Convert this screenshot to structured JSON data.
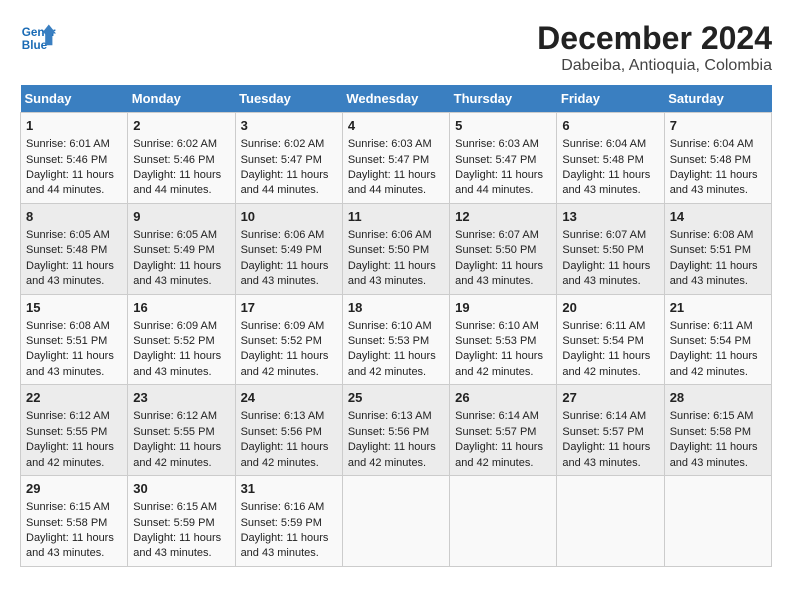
{
  "header": {
    "logo_line1": "General",
    "logo_line2": "Blue",
    "title": "December 2024",
    "subtitle": "Dabeiba, Antioquia, Colombia"
  },
  "calendar": {
    "days_of_week": [
      "Sunday",
      "Monday",
      "Tuesday",
      "Wednesday",
      "Thursday",
      "Friday",
      "Saturday"
    ],
    "weeks": [
      [
        {
          "day": 1,
          "sunrise": "6:01 AM",
          "sunset": "5:46 PM",
          "daylight": "11 hours and 44 minutes."
        },
        {
          "day": 2,
          "sunrise": "6:02 AM",
          "sunset": "5:46 PM",
          "daylight": "11 hours and 44 minutes."
        },
        {
          "day": 3,
          "sunrise": "6:02 AM",
          "sunset": "5:47 PM",
          "daylight": "11 hours and 44 minutes."
        },
        {
          "day": 4,
          "sunrise": "6:03 AM",
          "sunset": "5:47 PM",
          "daylight": "11 hours and 44 minutes."
        },
        {
          "day": 5,
          "sunrise": "6:03 AM",
          "sunset": "5:47 PM",
          "daylight": "11 hours and 44 minutes."
        },
        {
          "day": 6,
          "sunrise": "6:04 AM",
          "sunset": "5:48 PM",
          "daylight": "11 hours and 43 minutes."
        },
        {
          "day": 7,
          "sunrise": "6:04 AM",
          "sunset": "5:48 PM",
          "daylight": "11 hours and 43 minutes."
        }
      ],
      [
        {
          "day": 8,
          "sunrise": "6:05 AM",
          "sunset": "5:48 PM",
          "daylight": "11 hours and 43 minutes."
        },
        {
          "day": 9,
          "sunrise": "6:05 AM",
          "sunset": "5:49 PM",
          "daylight": "11 hours and 43 minutes."
        },
        {
          "day": 10,
          "sunrise": "6:06 AM",
          "sunset": "5:49 PM",
          "daylight": "11 hours and 43 minutes."
        },
        {
          "day": 11,
          "sunrise": "6:06 AM",
          "sunset": "5:50 PM",
          "daylight": "11 hours and 43 minutes."
        },
        {
          "day": 12,
          "sunrise": "6:07 AM",
          "sunset": "5:50 PM",
          "daylight": "11 hours and 43 minutes."
        },
        {
          "day": 13,
          "sunrise": "6:07 AM",
          "sunset": "5:50 PM",
          "daylight": "11 hours and 43 minutes."
        },
        {
          "day": 14,
          "sunrise": "6:08 AM",
          "sunset": "5:51 PM",
          "daylight": "11 hours and 43 minutes."
        }
      ],
      [
        {
          "day": 15,
          "sunrise": "6:08 AM",
          "sunset": "5:51 PM",
          "daylight": "11 hours and 43 minutes."
        },
        {
          "day": 16,
          "sunrise": "6:09 AM",
          "sunset": "5:52 PM",
          "daylight": "11 hours and 43 minutes."
        },
        {
          "day": 17,
          "sunrise": "6:09 AM",
          "sunset": "5:52 PM",
          "daylight": "11 hours and 42 minutes."
        },
        {
          "day": 18,
          "sunrise": "6:10 AM",
          "sunset": "5:53 PM",
          "daylight": "11 hours and 42 minutes."
        },
        {
          "day": 19,
          "sunrise": "6:10 AM",
          "sunset": "5:53 PM",
          "daylight": "11 hours and 42 minutes."
        },
        {
          "day": 20,
          "sunrise": "6:11 AM",
          "sunset": "5:54 PM",
          "daylight": "11 hours and 42 minutes."
        },
        {
          "day": 21,
          "sunrise": "6:11 AM",
          "sunset": "5:54 PM",
          "daylight": "11 hours and 42 minutes."
        }
      ],
      [
        {
          "day": 22,
          "sunrise": "6:12 AM",
          "sunset": "5:55 PM",
          "daylight": "11 hours and 42 minutes."
        },
        {
          "day": 23,
          "sunrise": "6:12 AM",
          "sunset": "5:55 PM",
          "daylight": "11 hours and 42 minutes."
        },
        {
          "day": 24,
          "sunrise": "6:13 AM",
          "sunset": "5:56 PM",
          "daylight": "11 hours and 42 minutes."
        },
        {
          "day": 25,
          "sunrise": "6:13 AM",
          "sunset": "5:56 PM",
          "daylight": "11 hours and 42 minutes."
        },
        {
          "day": 26,
          "sunrise": "6:14 AM",
          "sunset": "5:57 PM",
          "daylight": "11 hours and 42 minutes."
        },
        {
          "day": 27,
          "sunrise": "6:14 AM",
          "sunset": "5:57 PM",
          "daylight": "11 hours and 43 minutes."
        },
        {
          "day": 28,
          "sunrise": "6:15 AM",
          "sunset": "5:58 PM",
          "daylight": "11 hours and 43 minutes."
        }
      ],
      [
        {
          "day": 29,
          "sunrise": "6:15 AM",
          "sunset": "5:58 PM",
          "daylight": "11 hours and 43 minutes."
        },
        {
          "day": 30,
          "sunrise": "6:15 AM",
          "sunset": "5:59 PM",
          "daylight": "11 hours and 43 minutes."
        },
        {
          "day": 31,
          "sunrise": "6:16 AM",
          "sunset": "5:59 PM",
          "daylight": "11 hours and 43 minutes."
        },
        null,
        null,
        null,
        null
      ]
    ]
  }
}
